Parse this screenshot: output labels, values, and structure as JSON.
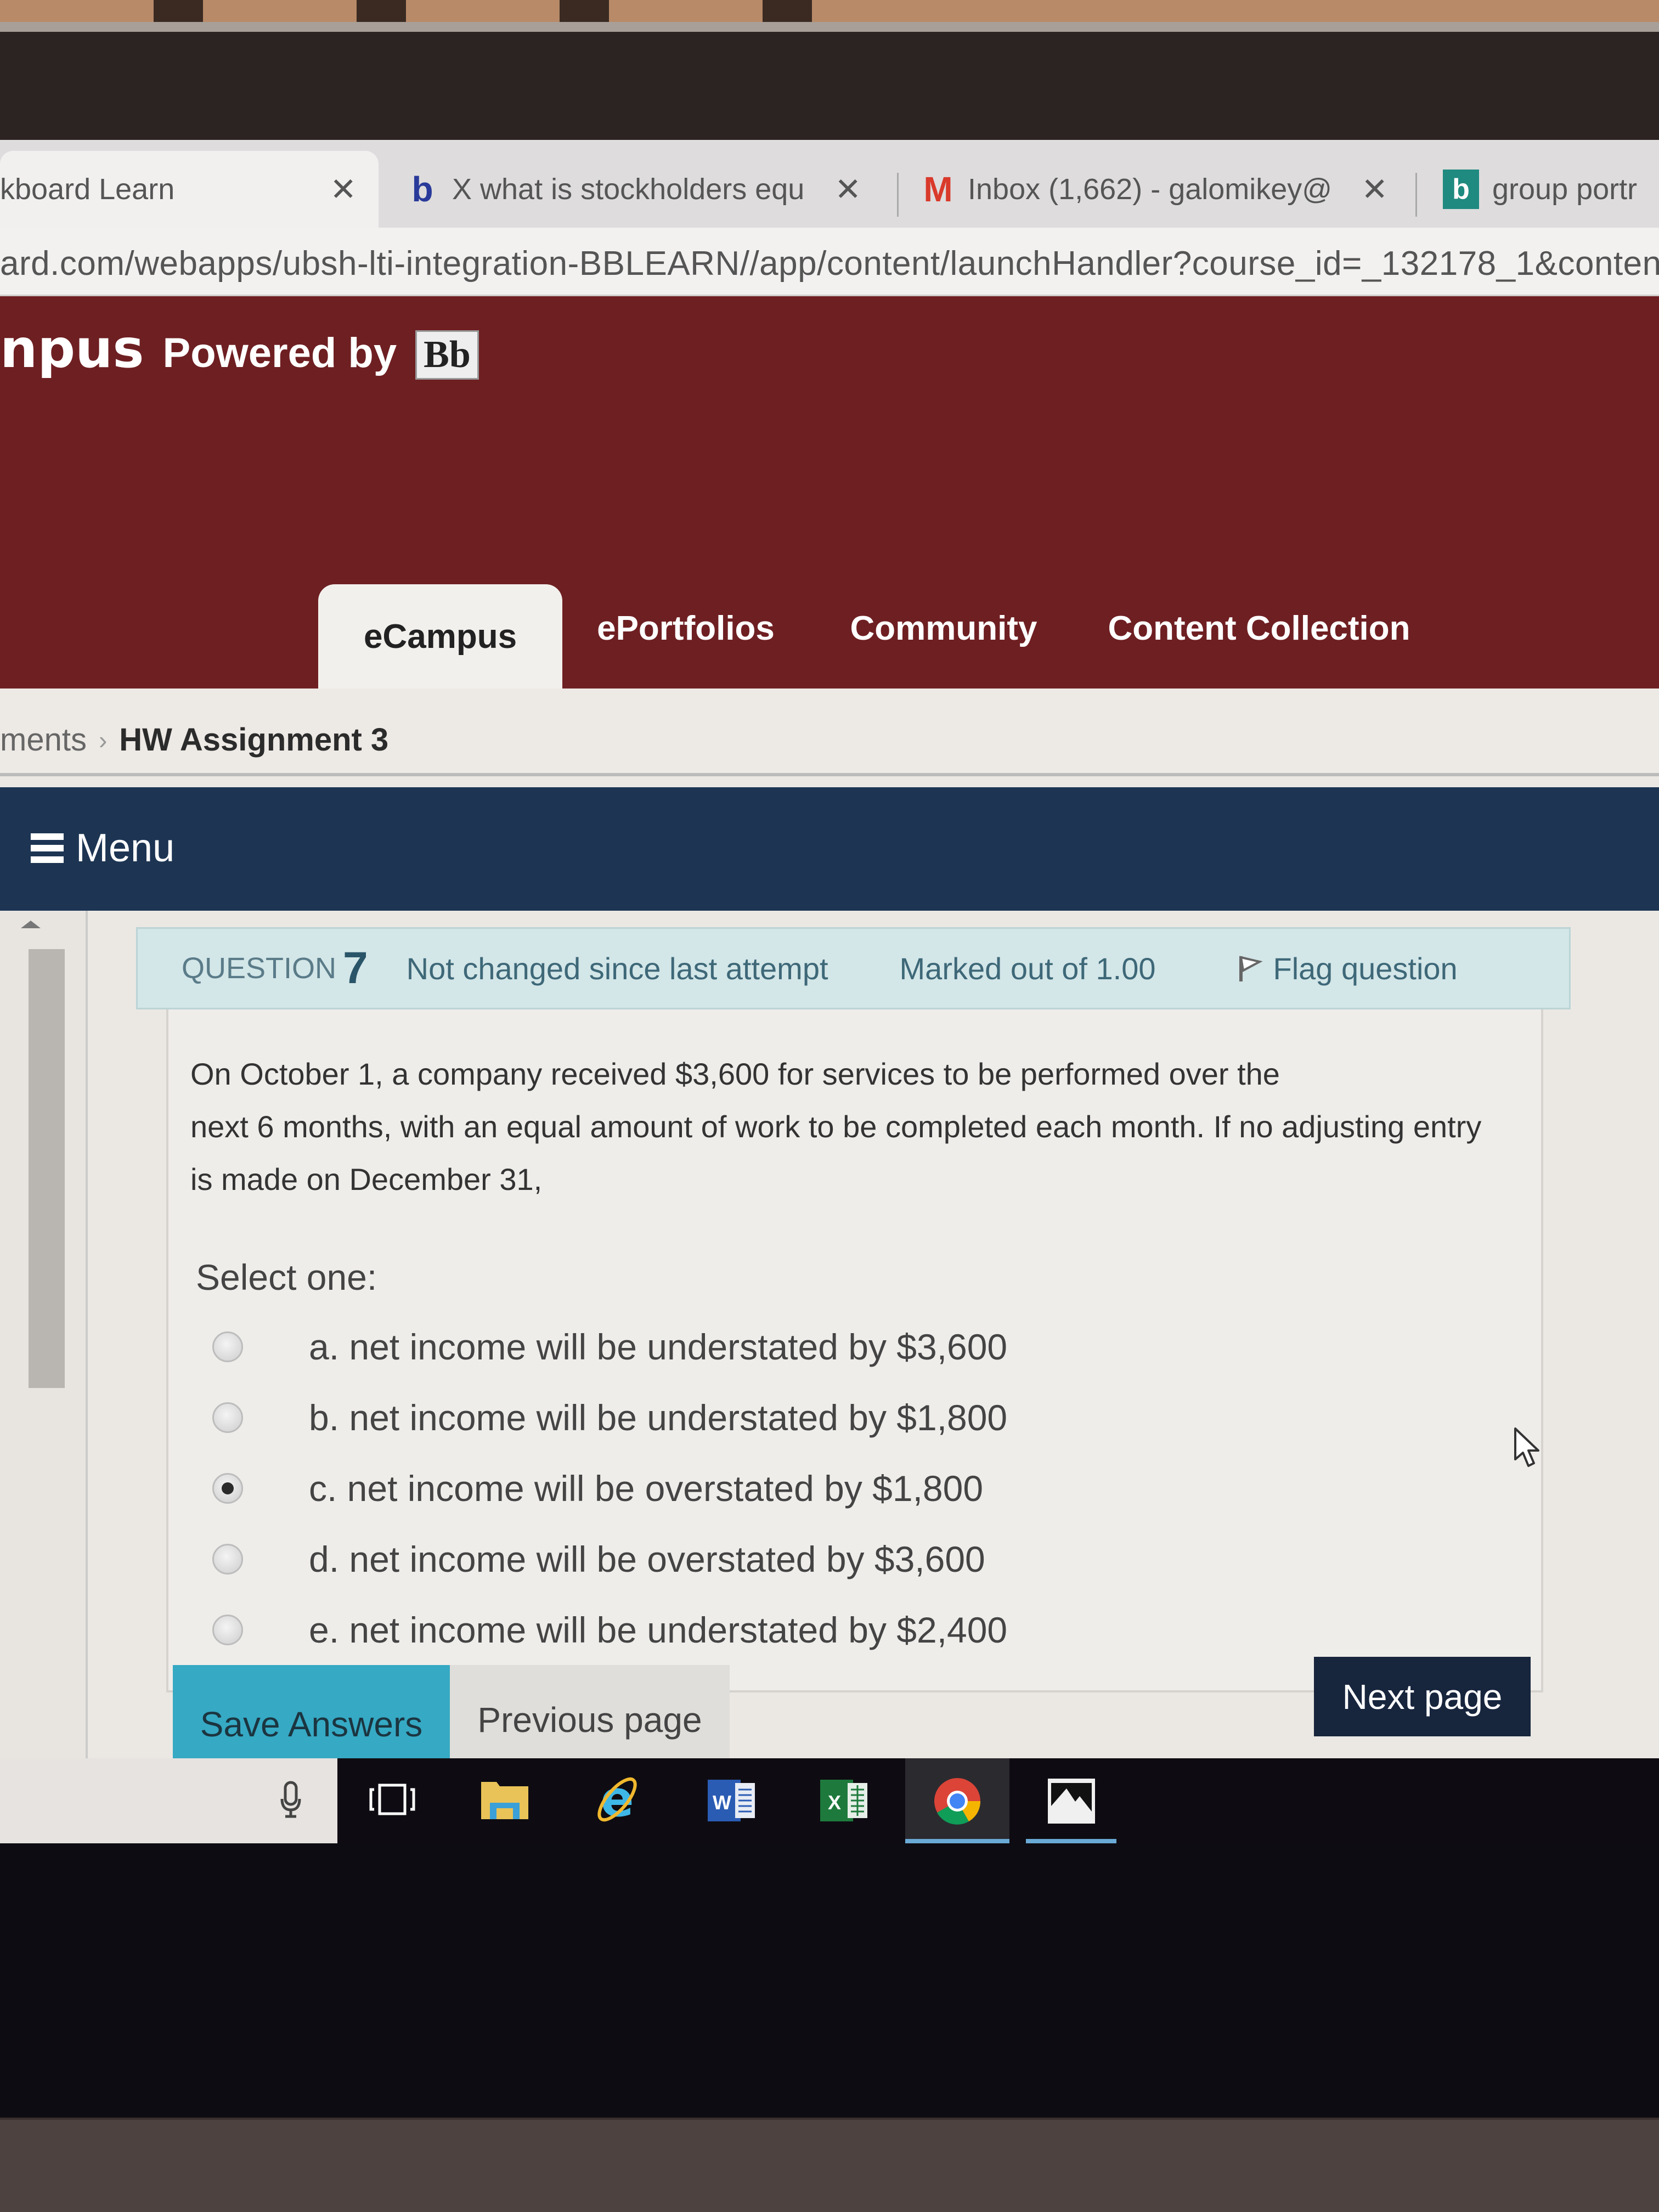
{
  "browser": {
    "tabs": [
      {
        "title": "kboard Learn",
        "favicon": "blackboard",
        "active": true
      },
      {
        "title": "X what is stockholders equ",
        "favicon": "bing-b",
        "active": false
      },
      {
        "title": "Inbox (1,662) - galomikey@",
        "favicon": "gmail-m",
        "active": false
      },
      {
        "title": "group portr",
        "favicon": "bing",
        "active": false
      }
    ],
    "close_glyph": "✕",
    "url": "ard.com/webapps/ubsh-lti-integration-BBLEARN//app/content/launchHandler?course_id=_132178_1&content"
  },
  "header": {
    "brand_partial": "npus",
    "powered_by": "Powered by",
    "logo_text": "Bb",
    "nav_tabs": [
      {
        "label": "eCampus",
        "active": true
      },
      {
        "label": "ePortfolios",
        "active": false
      },
      {
        "label": "Community",
        "active": false
      },
      {
        "label": "Content Collection",
        "active": false
      }
    ]
  },
  "breadcrumb": {
    "previous": "ments",
    "separator": "›",
    "current": "HW Assignment 3"
  },
  "menubar": {
    "menu_label": "Menu"
  },
  "question": {
    "label": "QUESTION",
    "number": "7",
    "status": "Not changed since last attempt",
    "marks": "Marked out of 1.00",
    "flag_label": "Flag question",
    "text_lines": [
      "On October 1, a company received $3,600 for services to be performed over the",
      "next 6 months, with an equal amount of work to be completed each month.  If no adjusting entry",
      "is made on December 31,"
    ],
    "prompt": "Select one:",
    "options": [
      {
        "label": "a. net income will be understated by $3,600",
        "selected": false
      },
      {
        "label": "b. net income will be understated by $1,800",
        "selected": false
      },
      {
        "label": "c. net income will be overstated by $1,800",
        "selected": true
      },
      {
        "label": "d. net income will be overstated by $3,600",
        "selected": false
      },
      {
        "label": "e. net income will be understated by $2,400",
        "selected": false
      }
    ]
  },
  "buttons": {
    "save": "Save Answers",
    "previous": "Previous page",
    "next": "Next page"
  },
  "taskbar": {
    "icons": [
      "microphone",
      "task-view",
      "file-explorer",
      "internet-explorer",
      "word",
      "excel",
      "chrome",
      "photos"
    ],
    "running": [
      "chrome",
      "photos"
    ]
  },
  "colors": {
    "header_maroon": "#6e1f22",
    "menubar_navy": "#1d3553",
    "question_header": "#d3e6e8",
    "save_button": "#36a9c4",
    "next_button": "#17253d"
  }
}
